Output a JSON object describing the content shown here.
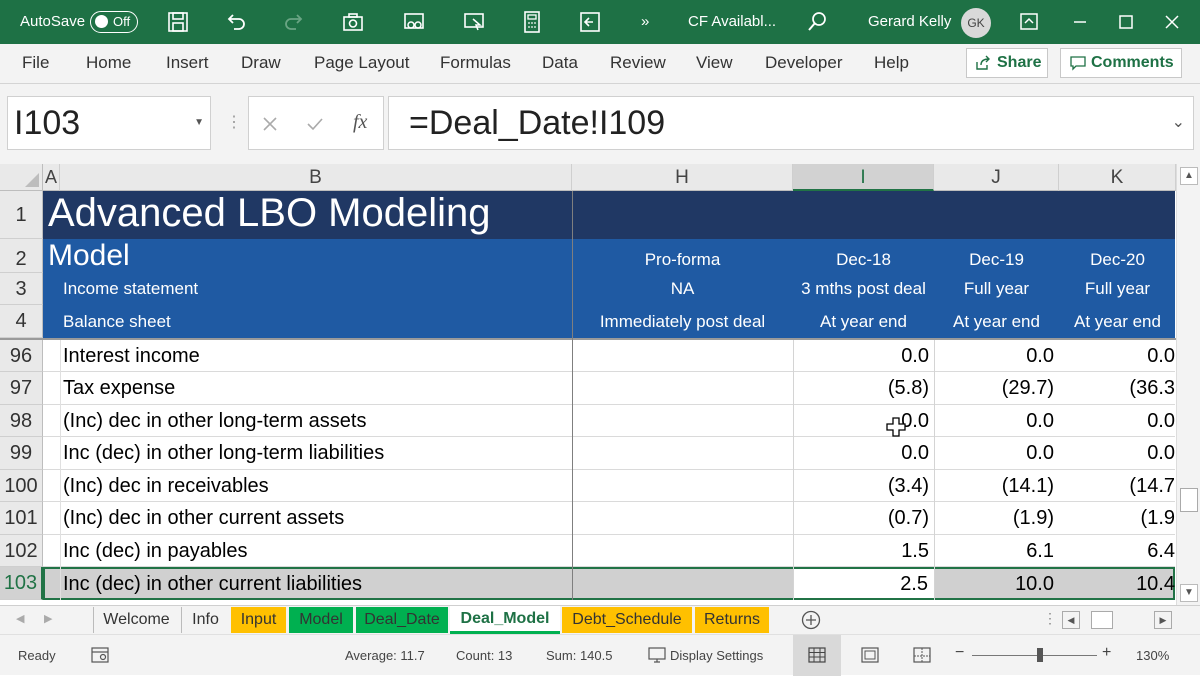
{
  "titlebar": {
    "autosave_label": "AutoSave",
    "autosave_state": "Off",
    "more_label": "»",
    "filename": "CF Availabl...",
    "user_name": "Gerard Kelly",
    "user_initials": "GK"
  },
  "ribbon": {
    "tabs": [
      "File",
      "Home",
      "Insert",
      "Draw",
      "Page Layout",
      "Formulas",
      "Data",
      "Review",
      "View",
      "Developer",
      "Help"
    ],
    "share_label": "Share",
    "comments_label": "Comments"
  },
  "formula_bar": {
    "name_box": "I103",
    "formula": "=Deal_Date!I109",
    "fx_label": "fx"
  },
  "columns": [
    "A",
    "B",
    "H",
    "I",
    "J",
    "K"
  ],
  "header_rows": {
    "title_row_num": "1",
    "title": "Advanced LBO Modeling",
    "model_row_num": "2",
    "model_label": "Model",
    "row3_num": "3",
    "row4_num": "4",
    "row2": [
      "Pro-forma",
      "Dec-18",
      "Dec-19",
      "Dec-20"
    ],
    "row3_label": "Income statement",
    "row3": [
      "NA",
      "3 mths post deal",
      "Full year",
      "Full year"
    ],
    "row4_label": "Balance sheet",
    "row4": [
      "Immediately post deal",
      "At year end",
      "At year end",
      "At year end"
    ]
  },
  "rows": [
    {
      "num": "96",
      "label": "Interest income",
      "i": "0.0",
      "j": "0.0",
      "k": "0.0"
    },
    {
      "num": "97",
      "label": "Tax expense",
      "i": "(5.8)",
      "j": "(29.7)",
      "k": "(36.3"
    },
    {
      "num": "98",
      "label": "(Inc) dec in other long-term assets",
      "i": "0.0",
      "j": "0.0",
      "k": "0.0"
    },
    {
      "num": "99",
      "label": "Inc (dec) in other long-term liabilities",
      "i": "0.0",
      "j": "0.0",
      "k": "0.0"
    },
    {
      "num": "100",
      "label": "(Inc) dec in receivables",
      "i": "(3.4)",
      "j": "(14.1)",
      "k": "(14.7"
    },
    {
      "num": "101",
      "label": "(Inc) dec in other current assets",
      "i": "(0.7)",
      "j": "(1.9)",
      "k": "(1.9"
    },
    {
      "num": "102",
      "label": "Inc (dec) in payables",
      "i": "1.5",
      "j": "6.1",
      "k": "6.4"
    },
    {
      "num": "103",
      "label": "Inc (dec) in other current liabilities",
      "i": "2.5",
      "j": "10.0",
      "k": "10.4"
    }
  ],
  "sheet_tabs": [
    {
      "label": "Welcome",
      "color": "none"
    },
    {
      "label": "Info",
      "color": "none"
    },
    {
      "label": "Input",
      "color": "#ffc000"
    },
    {
      "label": "Model",
      "color": "#00b050"
    },
    {
      "label": "Deal_Date",
      "color": "#00b050"
    },
    {
      "label": "Deal_Model",
      "color": "active"
    },
    {
      "label": "Debt_Schedule",
      "color": "#ffc000"
    },
    {
      "label": "Returns",
      "color": "#ffc000"
    }
  ],
  "status": {
    "ready": "Ready",
    "average": "Average: 11.7",
    "count": "Count: 13",
    "sum": "Sum: 140.5",
    "display_settings": "Display Settings",
    "zoom": "130%"
  },
  "colors": {
    "title_bg": "#203864",
    "header_bg": "#1f5aa3",
    "excel_green": "#1e7145",
    "selection_fill": "#d0d0d0"
  }
}
